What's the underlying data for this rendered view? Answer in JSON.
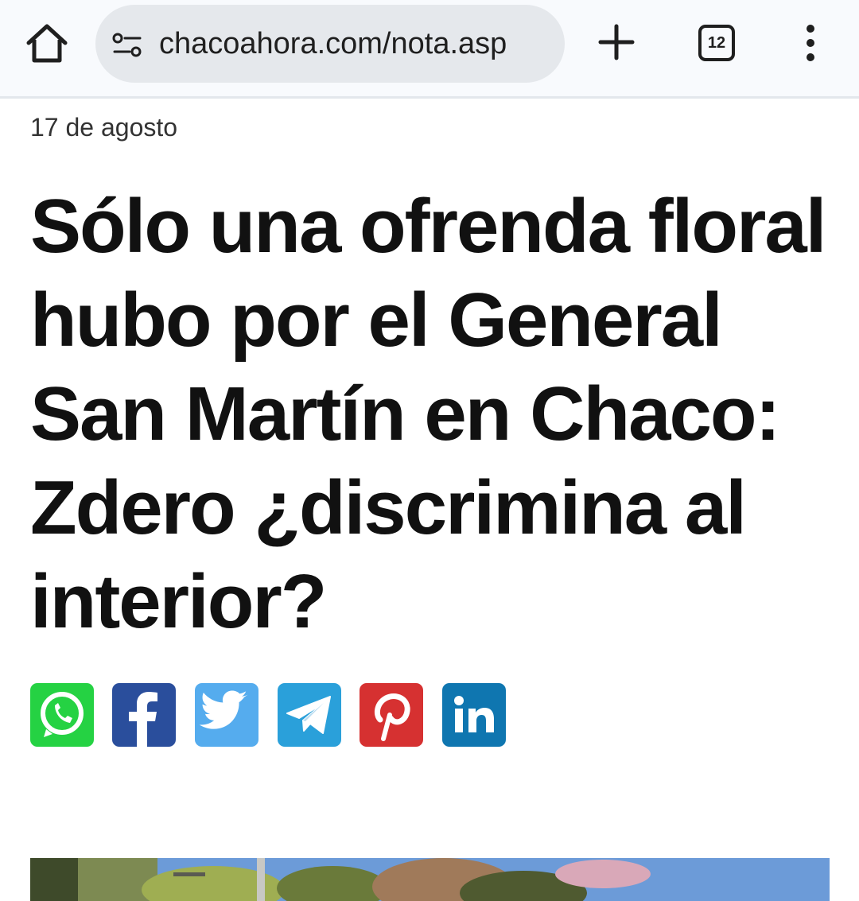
{
  "browser": {
    "url": "chacoahora.com/nota.asp",
    "tab_count": "12",
    "icons": [
      "home-icon",
      "site-settings-icon",
      "plus-icon",
      "tab-switcher-icon",
      "more-vert-icon"
    ]
  },
  "article": {
    "date": "17 de agosto",
    "headline": "Sólo una ofrenda floral hubo por el General San Martín en Chaco: Zdero ¿discrimina al interior?",
    "share_buttons": [
      {
        "network": "whatsapp",
        "icon": "whatsapp-icon",
        "color": "#25d243"
      },
      {
        "network": "facebook",
        "icon": "facebook-icon",
        "color": "#2a4e9c"
      },
      {
        "network": "twitter",
        "icon": "twitter-icon",
        "color": "#55acee"
      },
      {
        "network": "telegram",
        "icon": "telegram-icon",
        "color": "#2aa0da"
      },
      {
        "network": "pinterest",
        "icon": "pinterest-icon",
        "color": "#d63131"
      },
      {
        "network": "linkedin",
        "icon": "linkedin-icon",
        "color": "#0f76b0"
      }
    ]
  }
}
